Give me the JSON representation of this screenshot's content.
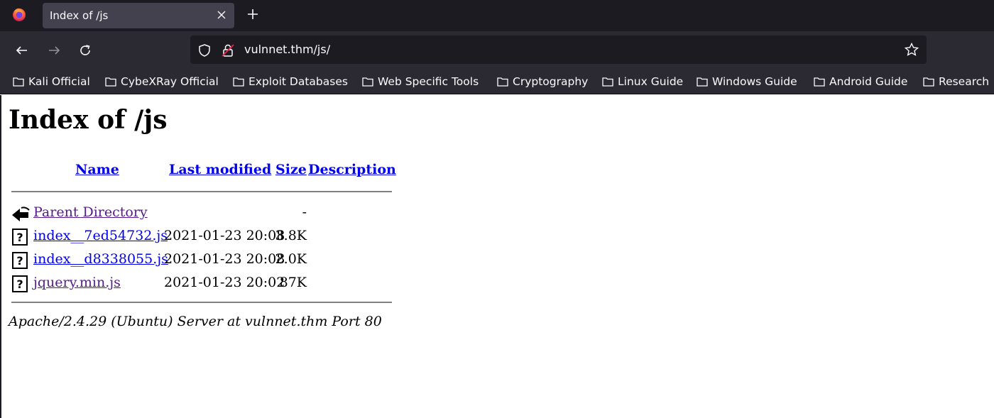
{
  "browser": {
    "tab_title": "Index of /js",
    "url": "vulnnet.thm/js/",
    "bookmarks": [
      "Kali Official",
      "CybeXRay Official",
      "Exploit Databases",
      "Web Specific Tools",
      "Cryptography",
      "Linux Guide",
      "Windows Guide",
      "Android Guide",
      "Research"
    ]
  },
  "page": {
    "heading": "Index of /js",
    "columns": {
      "name": "Name",
      "last_modified": "Last modified",
      "size": "Size",
      "description": "Description"
    },
    "rows": [
      {
        "icon": "back-icon",
        "name": "Parent Directory",
        "modified": "",
        "size": "-",
        "description": ""
      },
      {
        "icon": "unknown-file-icon",
        "name": "index__7ed54732.js",
        "modified": "2021-01-23 20:08",
        "size": "3.8K",
        "description": ""
      },
      {
        "icon": "unknown-file-icon",
        "name": "index__d8338055.js",
        "modified": "2021-01-23 20:08",
        "size": "2.0K",
        "description": ""
      },
      {
        "icon": "unknown-file-icon",
        "name": "jquery.min.js",
        "modified": "2021-01-23 20:02",
        "size": "87K",
        "description": ""
      }
    ],
    "footer": "Apache/2.4.29 (Ubuntu) Server at vulnnet.thm Port 80"
  },
  "colors": {
    "link_unvisited": "#0000ee",
    "link_visited": "#551a8b",
    "chrome_dark": "#1c1b22",
    "chrome_toolbar": "#2b2a33"
  }
}
